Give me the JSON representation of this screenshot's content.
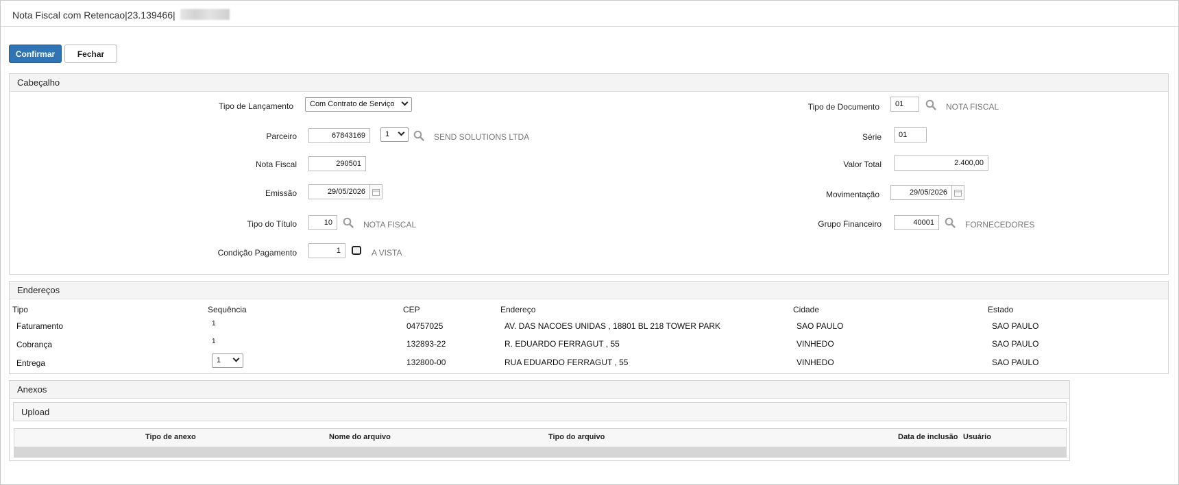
{
  "window": {
    "title": "Nota Fiscal com Retencao|23.139466|"
  },
  "toolbar": {
    "confirm_label": "Confirmar",
    "close_label": "Fechar"
  },
  "header_section": {
    "title": "Cabeçalho",
    "tipo_lancamento": {
      "label": "Tipo de Lançamento",
      "value": "Com Contrato de Serviço"
    },
    "parceiro": {
      "label": "Parceiro",
      "code": "67843169",
      "seq": "1",
      "desc": "SEND SOLUTIONS LTDA"
    },
    "nota_fiscal": {
      "label": "Nota Fiscal",
      "value": "290501"
    },
    "emissao": {
      "label": "Emissão",
      "value": "29/05/2026"
    },
    "tipo_titulo": {
      "label": "Tipo do Título",
      "value": "10",
      "desc": "NOTA FISCAL"
    },
    "condicao_pagamento": {
      "label": "Condição Pagamento",
      "value": "1",
      "desc": "A VISTA"
    },
    "tipo_documento": {
      "label": "Tipo de Documento",
      "value": "01",
      "desc": "NOTA FISCAL"
    },
    "serie": {
      "label": "Série",
      "value": "01"
    },
    "valor_total": {
      "label": "Valor Total",
      "value": "2.400,00"
    },
    "movimentacao": {
      "label": "Movimentação",
      "value": "29/05/2026"
    },
    "grupo_financeiro": {
      "label": "Grupo Financeiro",
      "value": "40001",
      "desc": "FORNECEDORES"
    }
  },
  "addresses": {
    "title": "Endereços",
    "columns": [
      "Tipo",
      "Sequência",
      "CEP",
      "Endereço",
      "Cidade",
      "Estado"
    ],
    "rows": [
      {
        "tipo": "Faturamento",
        "seq": "1",
        "cep": "04757025",
        "endereco": "AV. DAS NACOES UNIDAS , 18801 BL 218 TOWER PARK",
        "cidade": "SAO PAULO",
        "estado": "SAO PAULO"
      },
      {
        "tipo": "Cobrança",
        "seq": "1",
        "cep": "132893-22",
        "endereco": "R. EDUARDO FERRAGUT , 55",
        "cidade": "VINHEDO",
        "estado": "SAO PAULO"
      },
      {
        "tipo": "Entrega",
        "seq": "1",
        "cep": "132800-00",
        "endereco": "RUA EDUARDO FERRAGUT , 55",
        "cidade": "VINHEDO",
        "estado": "SAO PAULO"
      }
    ]
  },
  "attachments": {
    "title": "Anexos",
    "upload_title": "Upload",
    "columns": [
      "Tipo de anexo",
      "Nome do arquivo",
      "Tipo do arquivo",
      "Data de inclusão",
      "Usuário"
    ]
  },
  "icons": {
    "search": "search-icon",
    "calendar": "calendar-icon"
  },
  "colors": {
    "primary_button": "#2f74b5",
    "panel_header": "#f4f4f4"
  }
}
